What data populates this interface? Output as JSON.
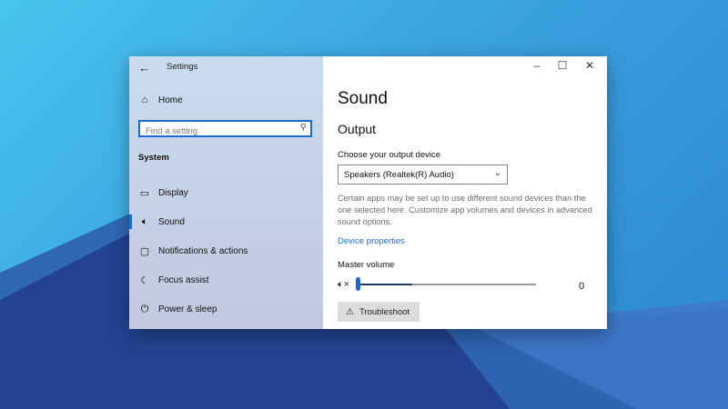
{
  "window": {
    "title": "Settings"
  },
  "sidebar": {
    "home_label": "Home",
    "search_placeholder": "Find a setting",
    "section_label": "System",
    "items": [
      {
        "label": "Display",
        "icon": "monitor-icon"
      },
      {
        "label": "Sound",
        "icon": "speaker-icon",
        "active": true
      },
      {
        "label": "Notifications & actions",
        "icon": "notifications-icon"
      },
      {
        "label": "Focus assist",
        "icon": "moon-icon"
      },
      {
        "label": "Power & sleep",
        "icon": "power-icon"
      }
    ]
  },
  "main": {
    "title": "Sound",
    "section_title": "Output",
    "device_label": "Choose your output device",
    "device_selected": "Speakers (Realtek(R) Audio)",
    "description": "Certain apps may be set up to use different sound devices than the one selected here. Customize app volumes and devices in advanced sound options.",
    "device_properties_link": "Device properties",
    "volume_label": "Master volume",
    "volume_value": "0",
    "volume_level": 0,
    "troubleshoot_label": "Troubleshoot"
  },
  "colors": {
    "accent": "#1a6bd1"
  }
}
